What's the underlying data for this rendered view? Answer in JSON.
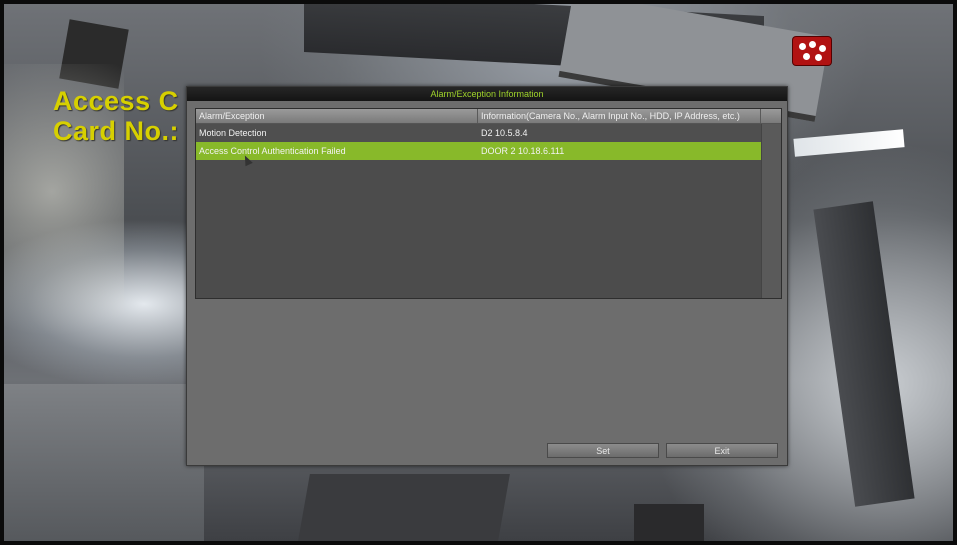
{
  "osd": {
    "line1": "Access C",
    "line2": "Card No.:"
  },
  "dialog": {
    "title": "Alarm/Exception Information",
    "columns": [
      "Alarm/Exception",
      "Information(Camera No., Alarm Input No., HDD, IP Address, etc.)"
    ],
    "rows": [
      {
        "type": "Motion Detection",
        "info": "D2  10.5.8.4",
        "selected": false
      },
      {
        "type": "Access Control Authentication Failed",
        "info": "DOOR 2  10.18.6.111",
        "selected": true
      }
    ],
    "buttons": {
      "set": "Set",
      "exit": "Exit"
    }
  },
  "colors": {
    "selected_row": "#88b92a",
    "title_text": "#9fd32a",
    "osd_text": "#d7d000"
  },
  "icons": [
    "record-indicator-icon",
    "mouse-cursor-icon"
  ]
}
